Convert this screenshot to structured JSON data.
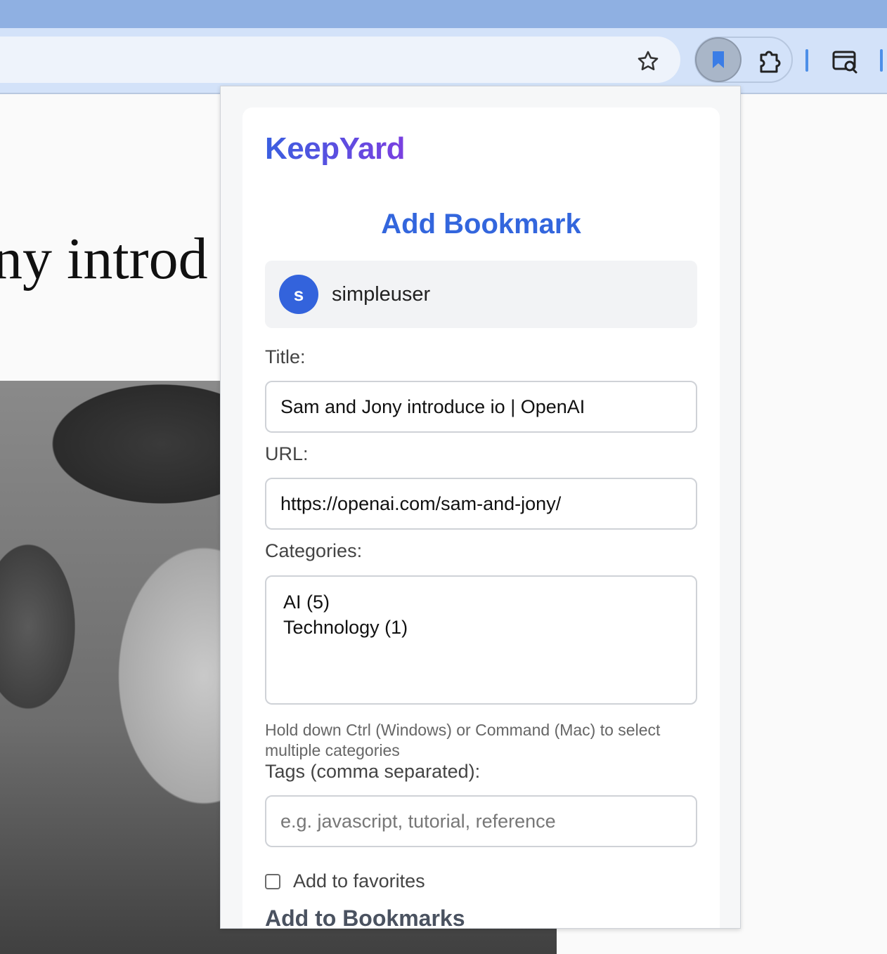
{
  "browser": {
    "bookmark_star_icon": "star-icon",
    "extension_icon": "bookmark-icon",
    "puzzle_icon": "puzzle-icon",
    "tab_search_icon": "tab-search-icon",
    "accent": "#4d8fe8"
  },
  "page": {
    "headline_fragment": "ny introd"
  },
  "popup": {
    "brand": "KeepYard",
    "heading": "Add Bookmark",
    "user": {
      "initial": "s",
      "name": "simpleuser"
    },
    "title_label": "Title:",
    "title_value": "Sam and Jony introduce io | OpenAI",
    "url_label": "URL:",
    "url_value": "https://openai.com/sam-and-jony/",
    "categories_label": "Categories:",
    "categories": [
      "AI (5)",
      "Technology (1)"
    ],
    "categories_hint": "Hold down Ctrl (Windows) or Command (Mac) to select multiple categories",
    "tags_label": "Tags (comma separated):",
    "tags_placeholder": "e.g. javascript, tutorial, reference",
    "favorites_label": "Add to favorites",
    "submit_label": "Add to Bookmarks",
    "colors": {
      "primary": "#3366dd",
      "brand_gradient_start": "#3a5fe0",
      "brand_gradient_end": "#7a3fe0"
    }
  }
}
